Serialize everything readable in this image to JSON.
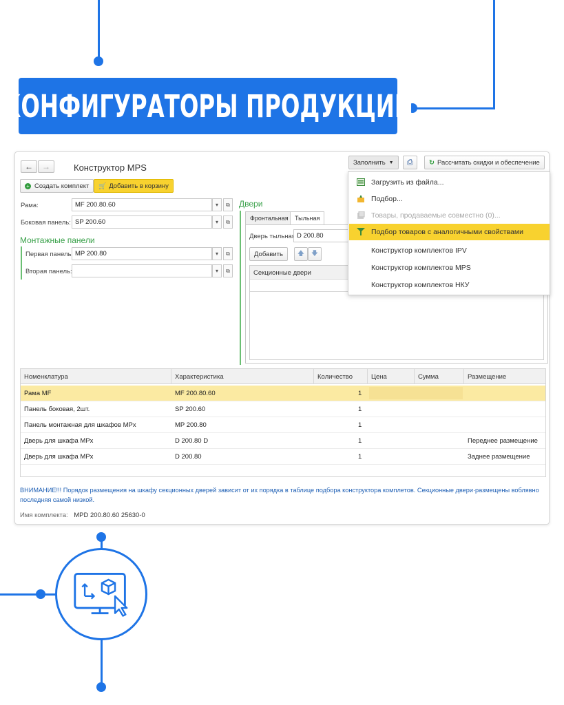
{
  "banner": {
    "title": "КОНФИГУРАТОРЫ ПРОДУКЦИИ"
  },
  "window": {
    "title": "Конструктор MPS",
    "buttons": {
      "create_kit": "Создать комплект",
      "add_to_cart": "Добавить в корзину",
      "fill": "Заполнить",
      "calc": "Рассчитать скидки и обеспечение"
    },
    "fields": {
      "frame_label": "Рама:",
      "frame_value": "MF 200.80.60",
      "side_label": "Боковая панель:",
      "side_value": "SP 200.60",
      "mount_section": "Монтажные панели",
      "first_label": "Первая панель:",
      "first_value": "MP 200.80",
      "second_label": "Вторая панель:",
      "second_value": ""
    },
    "doors": {
      "section": "Двери",
      "tabs": [
        "Фронтальная",
        "Тыльная"
      ],
      "rear_label": "Дверь тыльная:",
      "rear_value": "D 200.80",
      "add_button": "Добавить",
      "grid_header": "Секционные двери"
    },
    "table": {
      "columns": [
        "Номенклатура",
        "Характеристика",
        "Количество",
        "Цена",
        "Сумма",
        "Размещение"
      ],
      "rows": [
        {
          "name": "Рама MF",
          "char": "MF 200.80.60",
          "qty": "1",
          "price": "",
          "sum": "",
          "place": ""
        },
        {
          "name": "Панель боковая, 2шт.",
          "char": "SP 200.60",
          "qty": "1",
          "price": "",
          "sum": "",
          "place": ""
        },
        {
          "name": "Панель монтажная для шкафов MPx",
          "char": "MP 200.80",
          "qty": "1",
          "price": "",
          "sum": "",
          "place": ""
        },
        {
          "name": "Дверь для шкафа MPx",
          "char": "D 200.80 D",
          "qty": "1",
          "price": "",
          "sum": "",
          "place": "Переднее размещение"
        },
        {
          "name": "Дверь для шкафа MPx",
          "char": "D 200.80",
          "qty": "1",
          "price": "",
          "sum": "",
          "place": "Заднее размещение"
        }
      ]
    },
    "warning_line1": "ВНИМАНИЕ!!! Порядок размещения на шкафу секционных дверей зависит от их порядка в таблице подбора конструктора комплетов. Секционные двери·размещены воблявно",
    "warning_line2": "последняя самой низкой.",
    "kit_label": "Имя комплекта:",
    "kit_value": "MPD 200.80.60 25630-0"
  },
  "menu": {
    "items": [
      {
        "label": "Загрузить из файла...",
        "icon": "file-load-icon",
        "state": "normal"
      },
      {
        "label": "Подбор...",
        "icon": "selection-icon",
        "state": "normal"
      },
      {
        "label": "Товары, продаваемые совместно (0)...",
        "icon": "goods-icon",
        "state": "disabled"
      },
      {
        "label": "Подбор товаров с аналогичными свойствами",
        "icon": "filter-icon",
        "state": "highlighted"
      },
      {
        "label": "Конструктор комплектов IPV",
        "icon": "",
        "state": "normal"
      },
      {
        "label": "Конструктор комплектов MPS",
        "icon": "",
        "state": "normal"
      },
      {
        "label": "Конструктор комплектов НКУ",
        "icon": "",
        "state": "normal"
      }
    ]
  },
  "colors": {
    "accent": "#1e74e6",
    "highlight": "#f8d22f",
    "section_green": "#3aa14a",
    "selected_row": "#fbeaa2"
  }
}
